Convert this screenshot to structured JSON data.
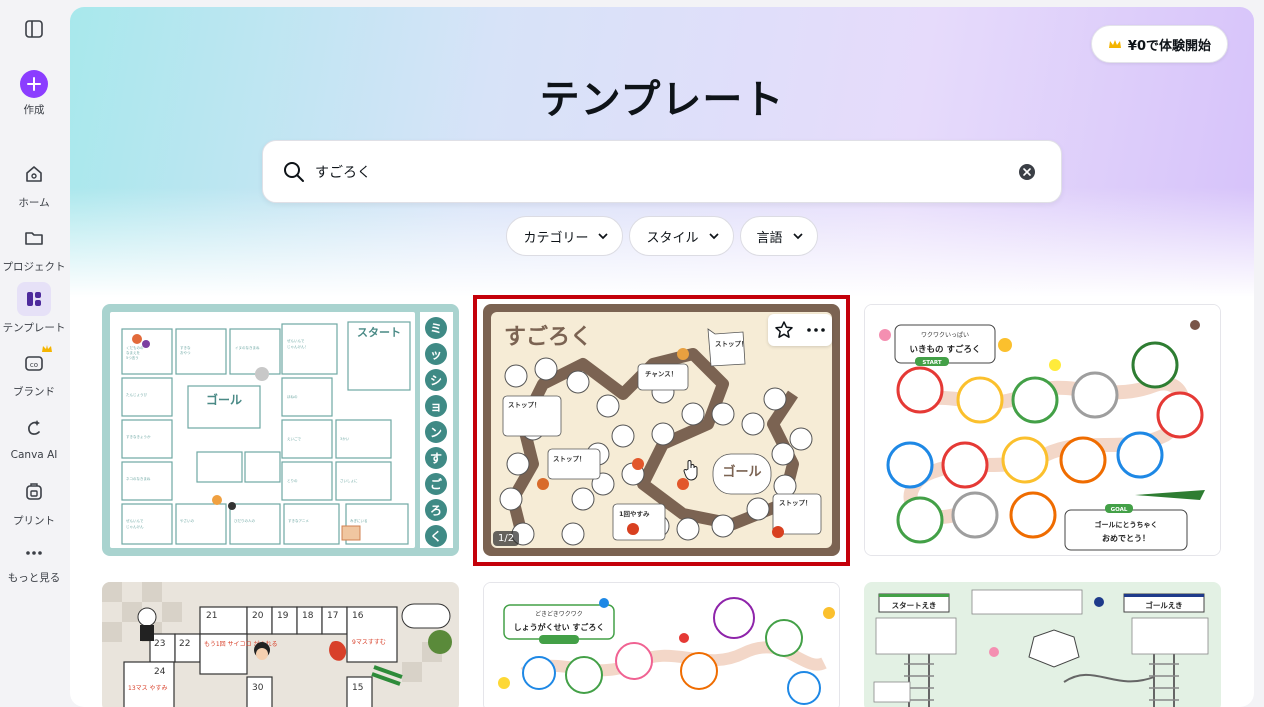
{
  "rail": {
    "items": [
      {
        "label": "作成"
      },
      {
        "label": "ホーム"
      },
      {
        "label": "プロジェクト"
      },
      {
        "label": "テンプレート"
      },
      {
        "label": "ブランド"
      },
      {
        "label": "Canva AI"
      },
      {
        "label": "プリント"
      },
      {
        "label": "もっと見る"
      }
    ]
  },
  "header": {
    "trial_label": "¥0で体験開始",
    "title": "テンプレート"
  },
  "search": {
    "value": "すごろく"
  },
  "filters": [
    {
      "label": "カテゴリー"
    },
    {
      "label": "スタイル"
    },
    {
      "label": "言語"
    }
  ],
  "templates": [
    {
      "side_title": [
        "ミ",
        "ッ",
        "シ",
        "ョ",
        "ン",
        "す",
        "ご",
        "ろ",
        "く"
      ],
      "start": "スタート",
      "goal": "ゴール"
    },
    {
      "title": "すごろく",
      "goal": "ゴール",
      "stop": "ストップ！",
      "chance": "チャンス！",
      "rest": "1回やすみ",
      "page_badge": "1/2"
    },
    {
      "title_small": "ワクワクいっぱい",
      "title": "いきもの すごろく",
      "start": "START",
      "goal": "GOAL",
      "goal_text": "ゴールにとうちゃく",
      "congrats": "おめでとう！"
    },
    {
      "labels": [
        "21",
        "20",
        "19",
        "18",
        "17",
        "16",
        "23",
        "22",
        "24",
        "30",
        "15",
        "9マスすすむ",
        "もう1回 サイコロ がふれる",
        "13マス やすみ"
      ]
    },
    {
      "title_small": "どきどきワクワク",
      "title": "しょうがくせい すごろく"
    },
    {
      "start": "スタートえき",
      "goal": "ゴールえき"
    }
  ],
  "colors": {
    "accent": "#8b3dff",
    "selection": "#c4000a"
  }
}
